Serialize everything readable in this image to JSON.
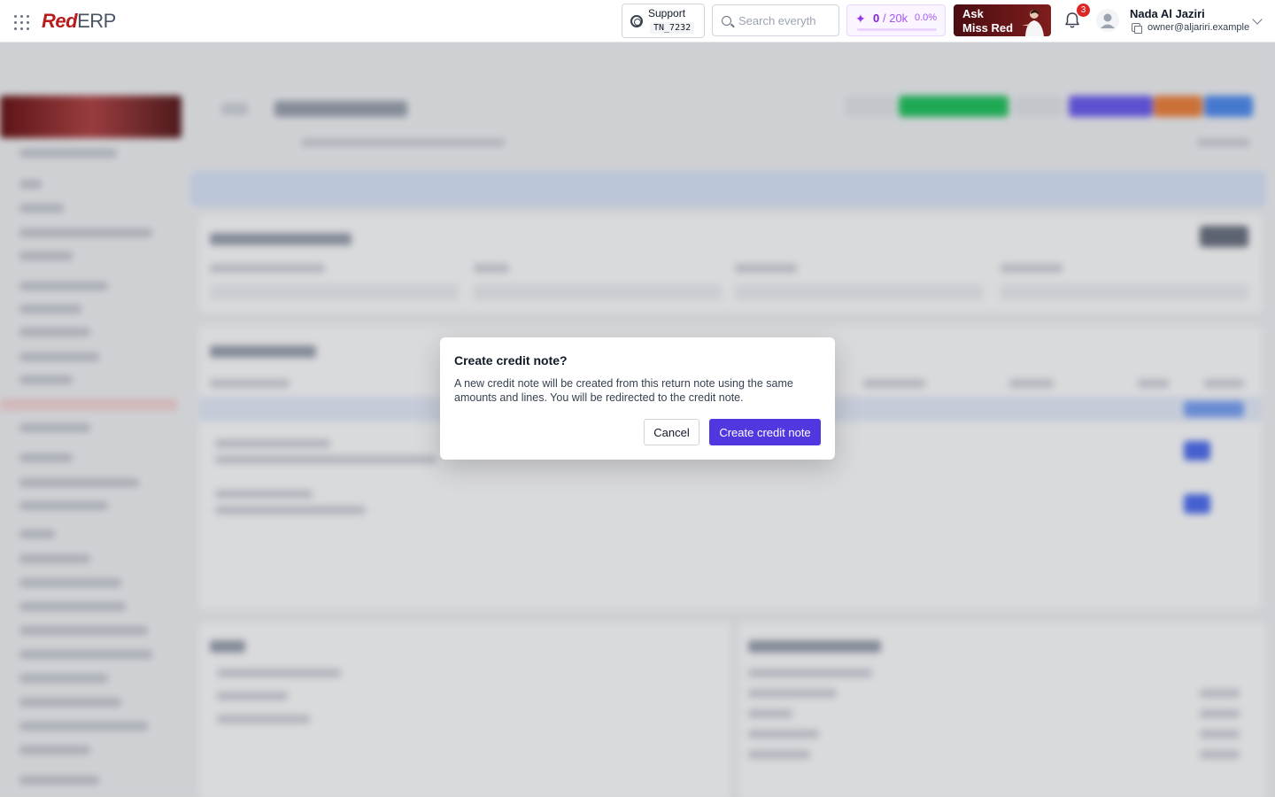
{
  "header": {
    "logo_red": "Red",
    "logo_erp": "ERP",
    "support": {
      "label": "Support",
      "code": "TN_7232"
    },
    "search": {
      "placeholder": "Search everyth"
    },
    "credits": {
      "used": "0",
      "separator_total": "/ 20k",
      "percent": "0.0%",
      "progress_fraction": 0.0
    },
    "ask": {
      "line1": "Ask",
      "line2": "Miss Red"
    },
    "notifications": {
      "count": "3"
    },
    "user": {
      "name": "Nada Al Jaziri",
      "email": "owner@aljariri.example"
    }
  },
  "dialog": {
    "title": "Create credit note?",
    "body": "A new credit note will be created from this return note using the same amounts and lines. You will be redirected to the credit note.",
    "cancel_label": "Cancel",
    "confirm_label": "Create credit note"
  },
  "colors": {
    "brand_red": "#b91c1c",
    "primary": "#4f38e0",
    "credits_purple": "#9333ea",
    "badge_red": "#dc2626"
  },
  "icons": [
    "apps-grid-icon",
    "lifebuoy-icon",
    "search-icon",
    "sparkles-icon",
    "bell-icon",
    "user-avatar-icon",
    "copy-icon",
    "chevron-down-icon"
  ]
}
